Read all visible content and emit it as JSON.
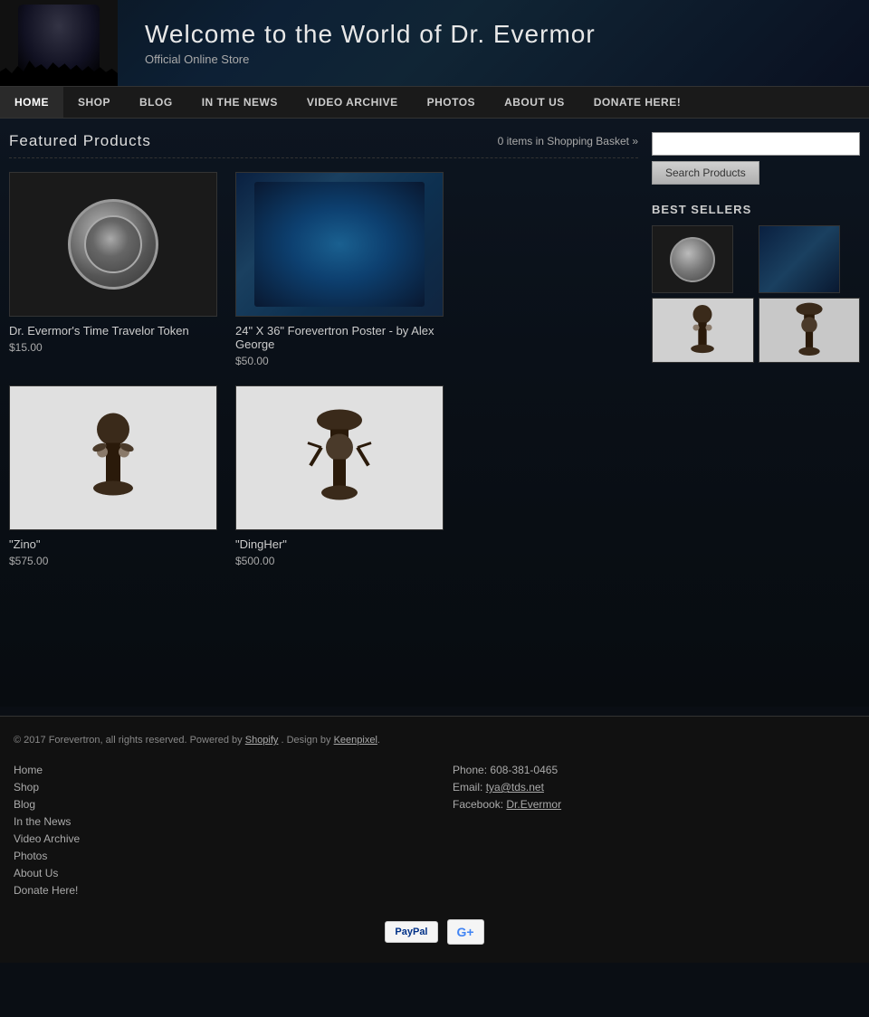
{
  "header": {
    "title": "Welcome to the World of Dr. Evermor",
    "subtitle": "Official Online Store"
  },
  "nav": {
    "items": [
      {
        "label": "HOME",
        "active": true
      },
      {
        "label": "SHOP",
        "active": false
      },
      {
        "label": "BLOG",
        "active": false
      },
      {
        "label": "IN THE NEWS",
        "active": false
      },
      {
        "label": "VIDEO ARCHIVE",
        "active": false
      },
      {
        "label": "PHOTOS",
        "active": false
      },
      {
        "label": "ABOUT US",
        "active": false
      },
      {
        "label": "DONATE HERE!",
        "active": false
      }
    ]
  },
  "page": {
    "title": "Featured Products",
    "cart": "0 items in Shopping Basket »"
  },
  "products": [
    {
      "name": "Dr. Evermor's Time Travelor Token",
      "price": "$15.00",
      "type": "token"
    },
    {
      "name": "24\" X 36\" Forevertron Poster - by Alex George",
      "price": "$50.00",
      "type": "poster"
    },
    {
      "name": "\"Zino\"",
      "price": "$575.00",
      "type": "zino"
    },
    {
      "name": "\"DingHer\"",
      "price": "$500.00",
      "type": "dingher"
    }
  ],
  "sidebar": {
    "search_placeholder": "",
    "search_button": "Search Products",
    "best_sellers_title": "BEST SELLERS"
  },
  "footer": {
    "copyright": "© 2017 Forevertron, all rights reserved. Powered by",
    "shopify": "Shopify",
    "design_by": ". Design by",
    "keenpixel": "Keenpixel",
    "nav_links": [
      "Home",
      "Shop",
      "Blog",
      "In the News",
      "Video Archive",
      "Photos",
      "About Us",
      "Donate Here!"
    ],
    "phone_label": "Phone:",
    "phone": "608-381-0465",
    "email_label": "Email:",
    "email": "tya@tds.net",
    "facebook_label": "Facebook:",
    "facebook": "Dr.Evermor",
    "payment_paypal": "PayPal",
    "payment_google": "G+"
  }
}
